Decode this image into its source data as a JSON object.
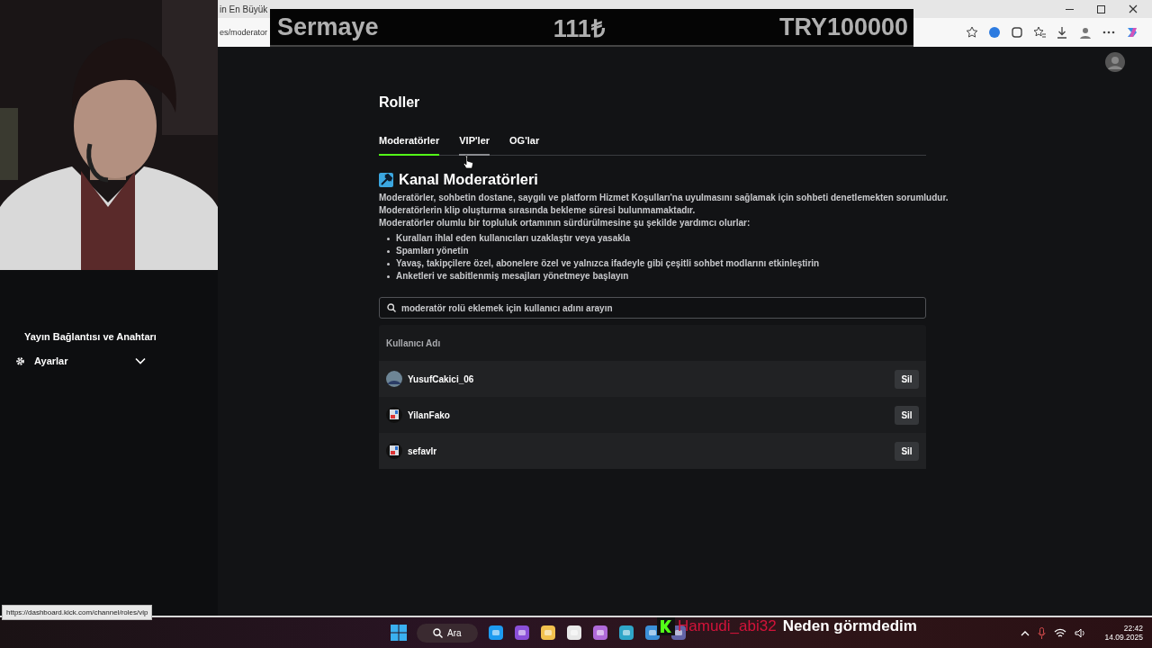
{
  "browser": {
    "tabs": [
      {
        "title": "in En Büyük"
      }
    ],
    "address": "es/moderator"
  },
  "ticker": {
    "label": "Sermaye",
    "amount": "111₺",
    "target": "TRY100000"
  },
  "sidebar": {
    "items": [
      {
        "kind": "link",
        "label": "Yayın Bağlantısı ve Anahtarı"
      },
      {
        "kind": "group",
        "label": "Ayarlar",
        "expanded": false
      }
    ]
  },
  "page": {
    "title": "Roller",
    "tabs": [
      {
        "label": "Moderatörler",
        "selected": true,
        "hovered": false
      },
      {
        "label": "VIP'ler",
        "selected": false,
        "hovered": true
      },
      {
        "label": "OG'lar",
        "selected": false,
        "hovered": false
      }
    ],
    "section": {
      "title": "Kanal Moderatörleri",
      "paragraphs": [
        "Moderatörler, sohbetin dostane, saygılı ve platform Hizmet Koşulları'na uyulmasını sağlamak için sohbeti denetlemekten sorumludur.",
        "Moderatörlerin klip oluşturma sırasında bekleme süresi bulunmamaktadır.",
        "Moderatörler olumlu bir topluluk ortamının sürdürülmesine şu şekilde yardımcı olurlar:"
      ],
      "bullets": [
        "Kuralları ihlal eden kullanıcıları uzaklaştır veya yasakla",
        "Spamları yönetin",
        "Yavaş, takipçilere özel, abonelere özel ve yalnızca ifadeyle gibi çeşitli sohbet modlarını etkinleştirin",
        "Anketleri ve sabitlenmiş mesajları yönetmeye başlayın"
      ]
    },
    "search": {
      "placeholder": "moderatör rolü eklemek için kullanıcı adını arayın"
    },
    "table": {
      "columns": [
        "Kullanıcı Adı"
      ],
      "rows": [
        {
          "username": "YusufCakici_06",
          "action": "Sil"
        },
        {
          "username": "YilanFako",
          "action": "Sil"
        },
        {
          "username": "sefavlr",
          "action": "Sil"
        }
      ]
    }
  },
  "status_url": "https://dashboard.kick.com/channel/roles/vip",
  "chat": {
    "user": "Hamudi_abi32",
    "message": "Neden görmdedim"
  },
  "taskbar": {
    "search": "Ara",
    "time": "22:42",
    "date": "14.09.2025"
  }
}
